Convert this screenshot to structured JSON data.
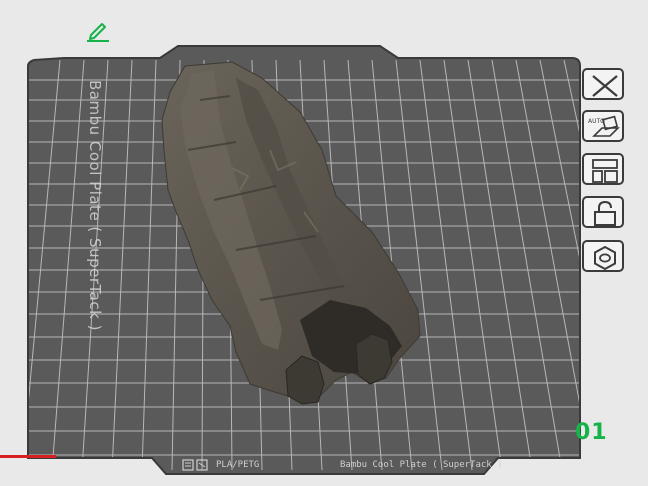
{
  "viewport": {
    "plate_name": "Bambu Cool Plate ( SuperTack )",
    "plate_number": "01",
    "footer_left": "PLA/PETG",
    "footer_right": "Bambu Cool Plate ( SuperTack )"
  },
  "toolbar": {
    "items": [
      {
        "name": "close",
        "icon": "close-icon"
      },
      {
        "name": "auto-orient",
        "icon": "auto-orient-icon",
        "badge": "AUTO"
      },
      {
        "name": "arrange",
        "icon": "arrange-icon"
      },
      {
        "name": "lock",
        "icon": "lock-icon"
      },
      {
        "name": "settings",
        "icon": "hexagon-gear-icon"
      }
    ]
  },
  "colors": {
    "plate": "#5a5a5a",
    "grid": "#c8c8c8",
    "model": "#5d574e",
    "accent_green": "#15b34a",
    "axis_red": "#d92020",
    "background": "#e9e9e9"
  }
}
